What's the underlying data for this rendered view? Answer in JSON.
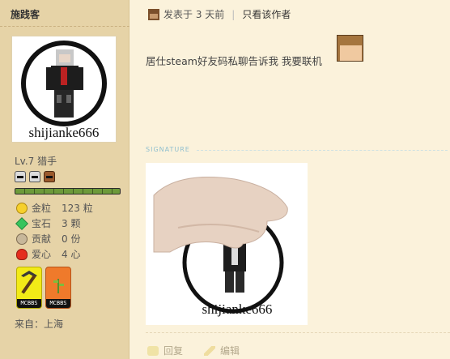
{
  "author": {
    "name": "施践客",
    "avatar_caption": "shijianke666",
    "level": "Lv.7 猎手",
    "xp_fraction": 1.0,
    "stats": [
      {
        "label": "金粒",
        "value": "123 粒",
        "icon": "gold-nugget-icon",
        "color": "#f6d02c"
      },
      {
        "label": "宝石",
        "value": "3 颗",
        "icon": "emerald-icon",
        "color": "#37c45d"
      },
      {
        "label": "贡献",
        "value": "0 份",
        "icon": "contribution-icon",
        "color": "#c7b79a"
      },
      {
        "label": "爱心",
        "value": "4 心",
        "icon": "heart-icon",
        "color": "#e52e1f"
      }
    ],
    "medals": [
      {
        "label": "MCBBS",
        "color": "#f2ea17"
      },
      {
        "label": "MCBBS",
        "color": "#ef7a2b"
      }
    ],
    "location": "来自：上海"
  },
  "post": {
    "posted_time": "发表于 3 天前",
    "separator": "|",
    "only_author": "只看该作者",
    "content": "居仕steam好友码私聊告诉我 我要联机",
    "signature_label": "SIGNATURE",
    "signature_caption": "shijianke666"
  },
  "footer": {
    "reply": "回复",
    "edit": "编辑"
  }
}
